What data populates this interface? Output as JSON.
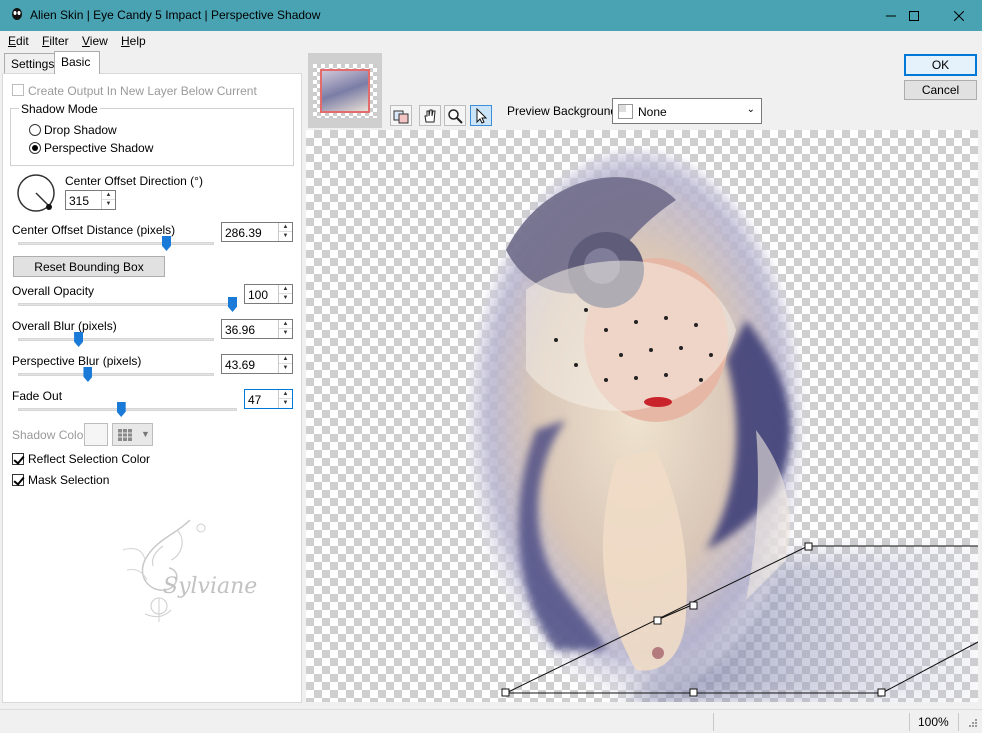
{
  "window": {
    "title": "Alien Skin | Eye Candy 5 Impact | Perspective Shadow",
    "controls": [
      "minimize-icon",
      "maximize-icon",
      "close-icon"
    ]
  },
  "menu": {
    "items": [
      {
        "mnemonic": "E",
        "rest": "dit"
      },
      {
        "mnemonic": "F",
        "rest": "ilter"
      },
      {
        "mnemonic": "V",
        "rest": "iew"
      },
      {
        "mnemonic": "H",
        "rest": "elp"
      }
    ]
  },
  "tabs": {
    "settings": "Settings",
    "basic": "Basic"
  },
  "basic": {
    "create_output_label": "Create Output In New Layer Below Current",
    "shadow_mode": {
      "legend": "Shadow Mode",
      "drop_shadow": "Drop Shadow",
      "perspective_shadow": "Perspective Shadow",
      "selected": "Perspective Shadow"
    },
    "direction": {
      "label": "Center Offset Direction (°)",
      "value": "315"
    },
    "offset_distance": {
      "label": "Center Offset Distance (pixels)",
      "value": "286.39",
      "level": 0.77
    },
    "reset_button": "Reset Bounding Box",
    "overall_opacity": {
      "label": "Overall Opacity",
      "value": "100",
      "level": 1.0
    },
    "overall_blur": {
      "label": "Overall Blur (pixels)",
      "value": "36.96",
      "level": 0.3
    },
    "perspective_blur": {
      "label": "Perspective Blur (pixels)",
      "value": "43.69",
      "level": 0.35
    },
    "fade_out": {
      "label": "Fade Out",
      "value": "47",
      "level": 0.47
    },
    "shadow_color_label": "Shadow Color",
    "reflect_label": "Reflect Selection Color",
    "mask_label": "Mask Selection"
  },
  "watermark": "Sylviane",
  "dialog": {
    "ok": "OK",
    "cancel": "Cancel"
  },
  "preview": {
    "background_label": "Preview Background:",
    "background_value": "None",
    "tools": [
      "preview-toggle-icon",
      "hand-icon",
      "zoom-icon",
      "pointer-icon"
    ]
  },
  "status": {
    "zoom": "100%"
  },
  "colors": {
    "titlebar": "#4aa3b3",
    "accent": "#0078d7",
    "slider": "#1a7ad8"
  }
}
